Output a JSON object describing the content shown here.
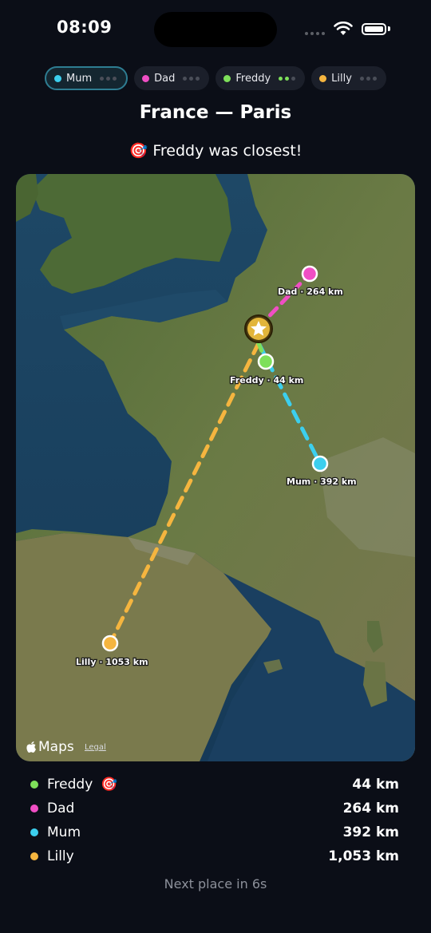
{
  "status": {
    "time": "08:09"
  },
  "players": [
    {
      "name": "Mum",
      "color": "#3ccfee",
      "active": true
    },
    {
      "name": "Dad",
      "color": "#f04ec4",
      "active": false
    },
    {
      "name": "Freddy",
      "color": "#7ee05a",
      "active": false
    },
    {
      "name": "Lilly",
      "color": "#f5b53f",
      "active": false
    }
  ],
  "round": {
    "title": "France — Paris",
    "result_emoji": "🎯",
    "result_text": "Freddy was closest!"
  },
  "map": {
    "brand": "Maps",
    "legal": "Legal",
    "labels": {
      "dad": "Dad · 264 km",
      "freddy": "Freddy · 44 km",
      "mum": "Mum · 392 km",
      "lilly": "Lilly · 1053 km"
    },
    "target_icon": "star-icon"
  },
  "scores": [
    {
      "name": "Freddy",
      "badge": "🎯",
      "distance": "44 km",
      "color": "#7ee05a"
    },
    {
      "name": "Dad",
      "badge": "",
      "distance": "264 km",
      "color": "#f04ec4"
    },
    {
      "name": "Mum",
      "badge": "",
      "distance": "392 km",
      "color": "#3ccfee"
    },
    {
      "name": "Lilly",
      "badge": "",
      "distance": "1,053 km",
      "color": "#f5b53f"
    }
  ],
  "footer": {
    "next_text": "Next place in 6s"
  }
}
